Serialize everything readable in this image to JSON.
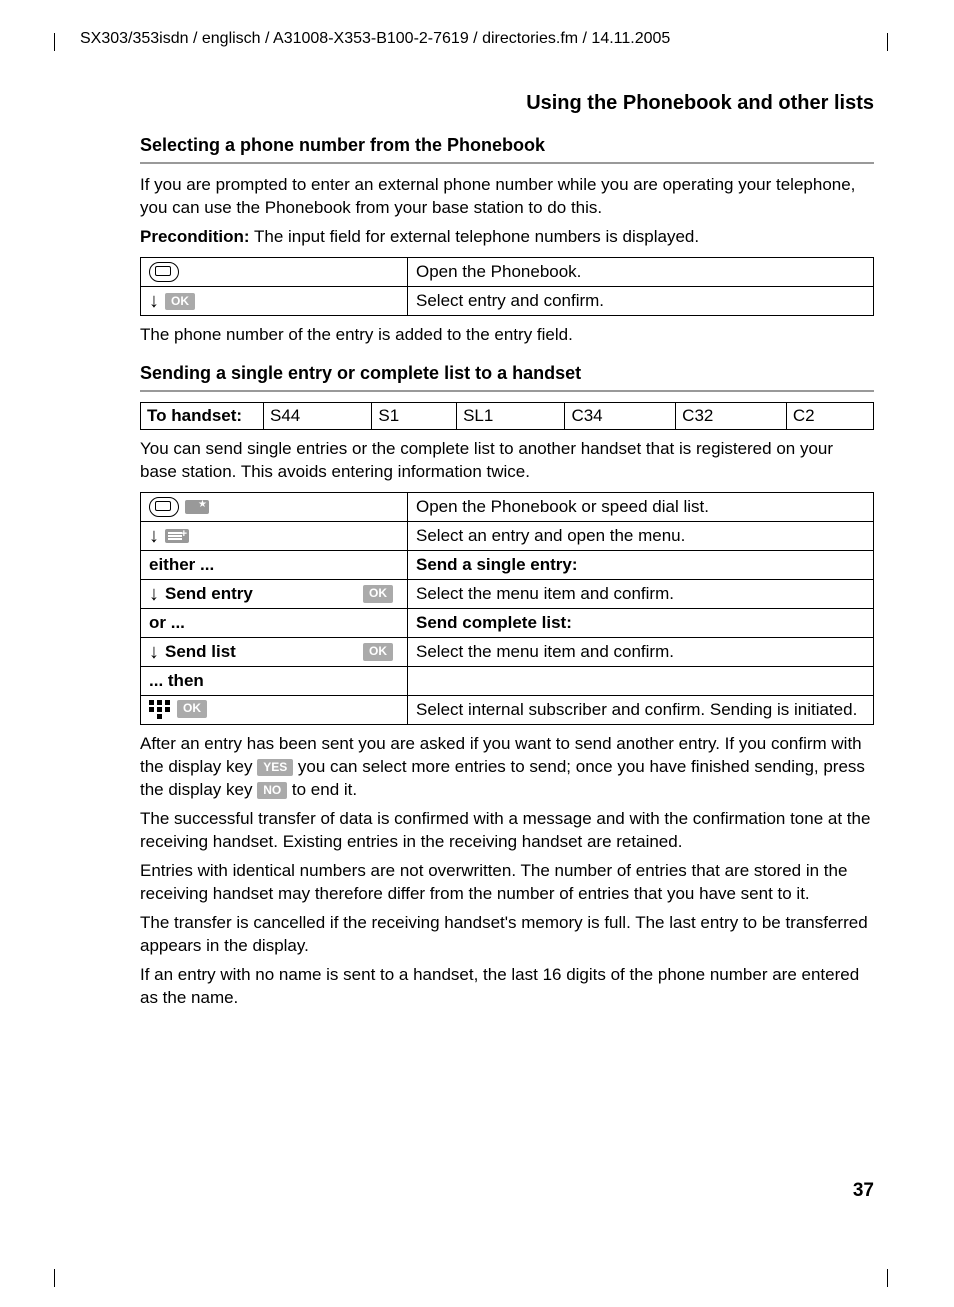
{
  "header_path": "SX303/353isdn / englisch / A31008-X353-B100-2-7619 / directories.fm / 14.11.2005",
  "section_title": "Using the Phonebook and other lists",
  "sub1": "Selecting a phone number from the Phonebook",
  "p1": "If you are prompted to enter an external phone number while you are operating your telephone, you can use the Phonebook from your base station to do this.",
  "precondition_label": "Precondition:",
  "precondition_text": " The input field for external telephone numbers is displayed.",
  "t1": {
    "r1_desc": "Open the Phonebook.",
    "r2_desc": "Select entry and confirm."
  },
  "p2": "The phone number of the entry is added to the entry field.",
  "sub2": "Sending a single entry or complete list to a handset",
  "handset": {
    "label": "To handset:",
    "c1": "S44",
    "c2": "S1",
    "c3": "SL1",
    "c4": "C34",
    "c5": "C32",
    "c6": "C2"
  },
  "p3": "You can send single entries or the complete list to another handset that is registered on your base station. This avoids entering information twice.",
  "t2": {
    "r1_desc": "Open the Phonebook or speed dial list.",
    "r2_desc": "Select an entry and open the menu.",
    "either": "either ...",
    "send_single": "Send a single entry:",
    "send_entry": "Send entry",
    "r3_desc": "Select the menu item and confirm.",
    "or": "or ...",
    "send_complete": "Send complete list:",
    "send_list": "Send list",
    "r4_desc": "Select the menu item and confirm.",
    "then": "... then",
    "r5_desc": "Select internal subscriber and confirm. Sending is initiated."
  },
  "ok_label": "OK",
  "yes_label": "YES",
  "no_label": "NO",
  "p4a": "After an entry has been sent you are asked if you want to send another entry. If you confirm with the display key ",
  "p4b": " you can select more entries to send; once you have finished sending, press the display key ",
  "p4c": " to end it.",
  "p5": "The successful transfer of data is confirmed with a message and with the confirmation tone at the receiving handset. Existing entries in the receiving handset are retained.",
  "p6": "Entries with identical numbers are not overwritten. The number of entries that are stored in the receiving handset may therefore differ from the number of entries that you have sent to it.",
  "p7": "The transfer is cancelled if the receiving handset's memory is full. The last entry to be transferred appears in the display.",
  "p8": "If an entry with no name is sent to a handset, the last 16 digits of the phone number are entered as the name.",
  "page_number": "37"
}
